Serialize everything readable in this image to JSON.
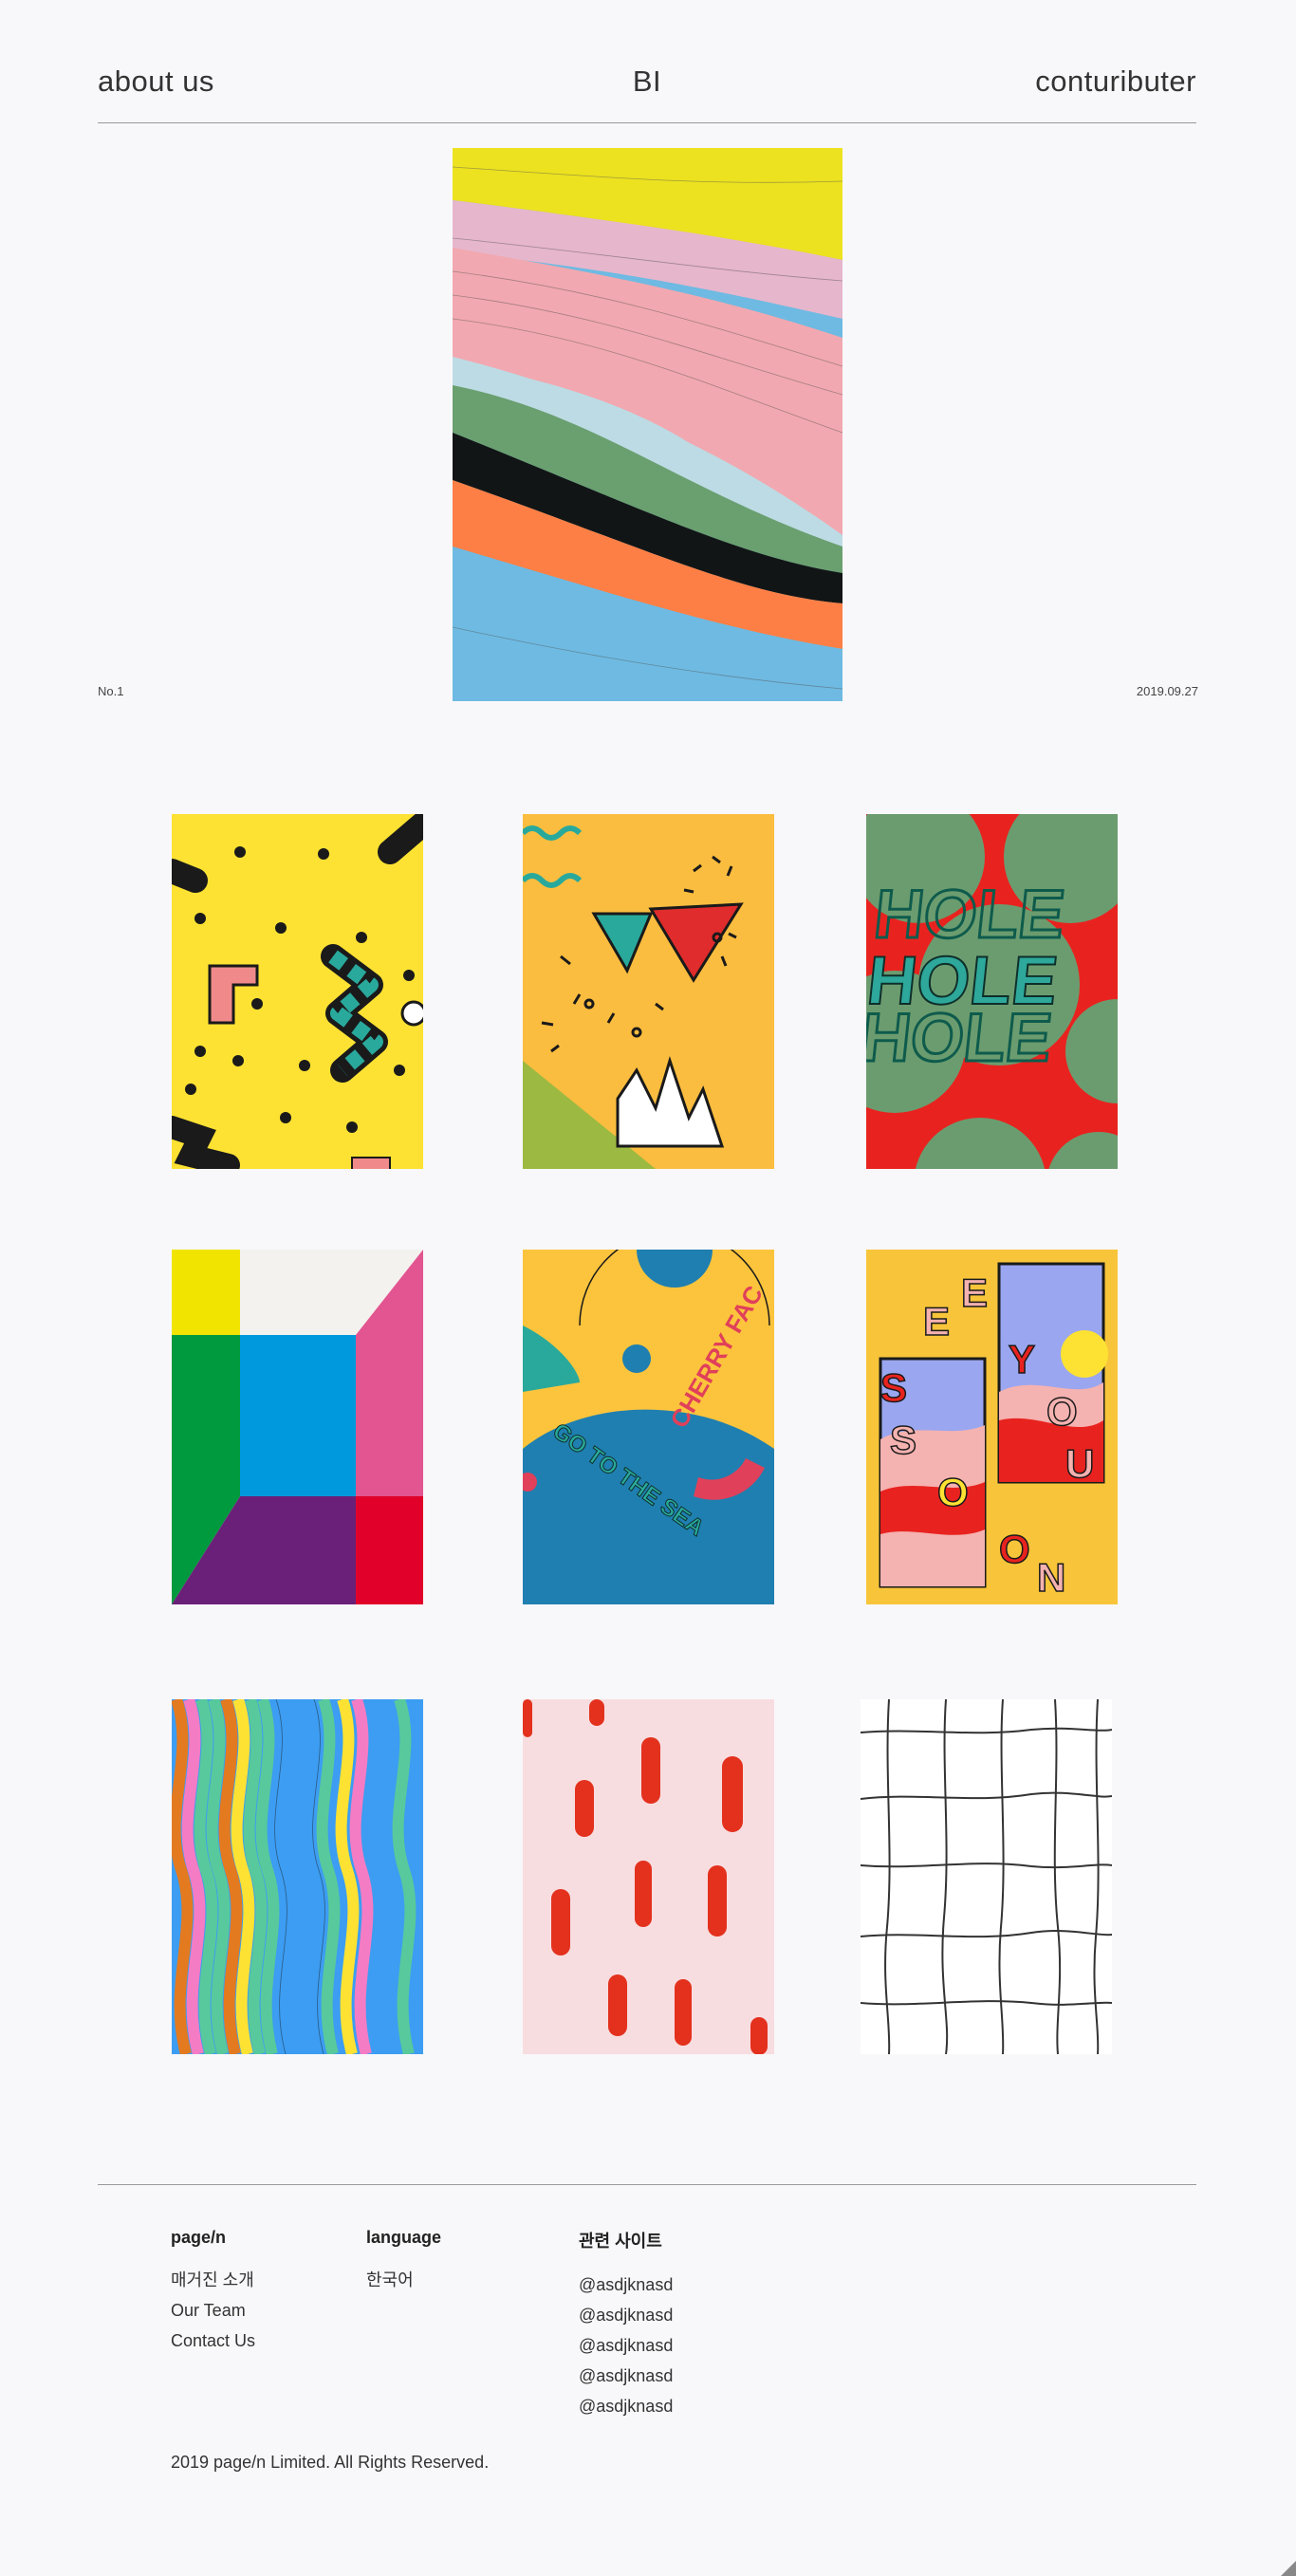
{
  "nav": {
    "about": "about us",
    "logo": "BI",
    "contributor": "contuributer"
  },
  "hero": {
    "issue": "No.1",
    "date": "2019.09.27",
    "colors": [
      "#ece21f",
      "#e6b6cc",
      "#f2a8b0",
      "#bddbe4",
      "#6a9f70",
      "#121515",
      "#fd7f45",
      "#6ebae2"
    ]
  },
  "gallery": [
    {
      "title": "yellow memphis pattern"
    },
    {
      "title": "orange triangles pattern"
    },
    {
      "title": "HOLE",
      "text": "HOLE"
    },
    {
      "title": "color room"
    },
    {
      "title": "go to the sea",
      "text_a": "CHERRY FAC",
      "text_b": "GO TO THE SEA"
    },
    {
      "title": "see you soon",
      "text": "SEE YOU SOON"
    },
    {
      "title": "wavy stripes"
    },
    {
      "title": "red brush strokes"
    },
    {
      "title": "hand-drawn grid"
    }
  ],
  "footer": {
    "col1": {
      "heading": "page/n",
      "items": [
        "매거진 소개",
        "Our Team",
        "Contact Us"
      ]
    },
    "col2": {
      "heading": "language",
      "items": [
        "한국어"
      ]
    },
    "col3": {
      "heading": "관련 사이트",
      "items": [
        "@asdjknasd",
        "@asdjknasd",
        "@asdjknasd",
        "@asdjknasd",
        "@asdjknasd"
      ]
    },
    "copyright": "2019 page/n Limited. All Rights Reserved."
  }
}
